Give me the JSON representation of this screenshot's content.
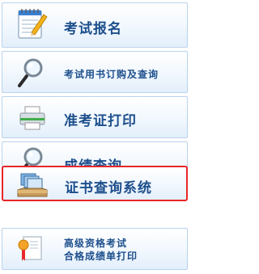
{
  "menu": {
    "items": [
      {
        "name": "exam-registration",
        "label": "考试报名"
      },
      {
        "name": "book-order-query",
        "label": "考试用书订购及查询"
      },
      {
        "name": "admission-ticket-print",
        "label": "准考证打印"
      },
      {
        "name": "score-query",
        "label": "成绩查询"
      },
      {
        "name": "certificate-query",
        "label": "证书查询系统"
      },
      {
        "name": "senior-qualification",
        "line1": "高级资格考试",
        "line2": "合格成绩单打印"
      }
    ]
  },
  "colors": {
    "label": "#1d4f8c",
    "active_border": "#e8262a",
    "item_border": "#b9d3ec"
  },
  "icons": [
    "notepad-pencil-icon",
    "magnifier-icon",
    "printer-icon",
    "magnifier-icon",
    "file-tray-icon",
    "certificate-ribbon-icon"
  ]
}
